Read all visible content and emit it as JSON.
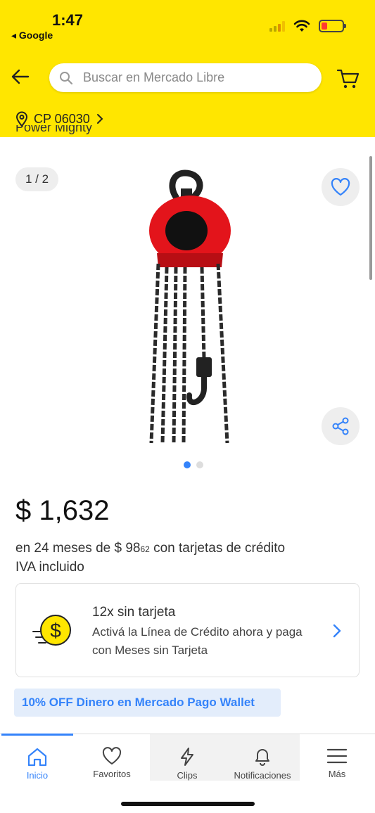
{
  "status_bar": {
    "time": "1:47",
    "back_app": "◂ Google"
  },
  "header": {
    "search_placeholder": "Buscar en Mercado Libre",
    "postal_code": "CP 06030"
  },
  "product": {
    "cut_title_text": "Power Mighty",
    "image_counter": "1 / 2",
    "image_count": 2,
    "active_image_index": 1,
    "price": "$ 1,632",
    "installment_prefix": "en 24 meses de $ 98",
    "installment_cents": "62",
    "installment_suffix": " con tarjetas de crédito",
    "tax_note": "IVA incluido"
  },
  "credit_offer": {
    "title": "12x sin tarjeta",
    "description": "Activá la Línea de Crédito ahora y paga con Meses sin Tarjeta"
  },
  "promo": {
    "label": "10% OFF Dinero en Mercado Pago Wallet"
  },
  "bottom_nav": {
    "items": [
      {
        "label": "Inicio",
        "icon": "home-icon",
        "active": true
      },
      {
        "label": "Favoritos",
        "icon": "heart-icon",
        "active": false
      },
      {
        "label": "Clips",
        "icon": "bolt-icon",
        "active": false
      },
      {
        "label": "Notificaciones",
        "icon": "bell-icon",
        "active": false
      },
      {
        "label": "Más",
        "icon": "menu-icon",
        "active": false
      }
    ]
  },
  "colors": {
    "brand_yellow": "#ffe600",
    "accent_blue": "#3483fa",
    "product_red": "#e3141b"
  }
}
